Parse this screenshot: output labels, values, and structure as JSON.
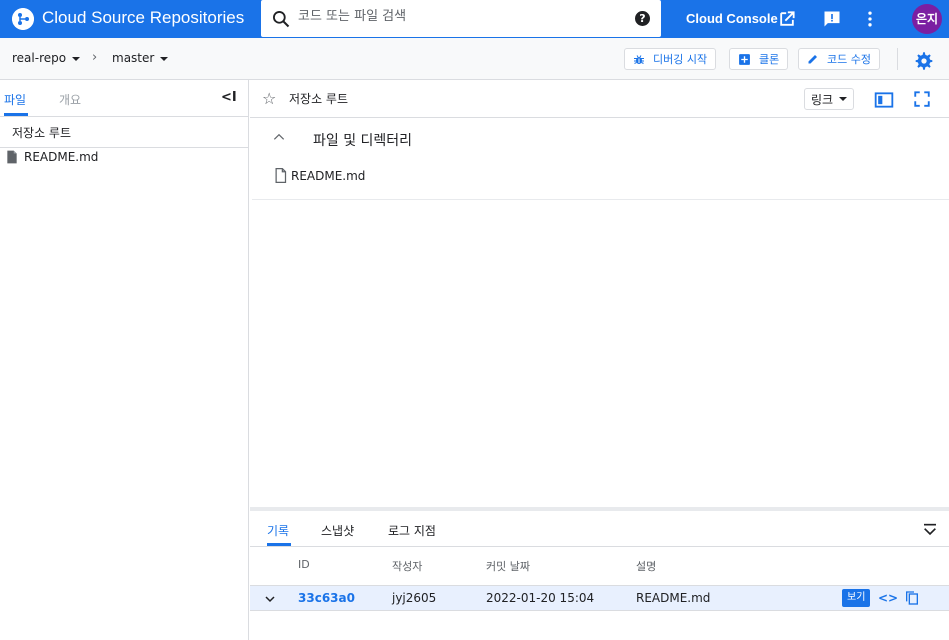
{
  "app": {
    "title": "Cloud Source Repositories"
  },
  "search": {
    "placeholder": "코드 또는 파일 검색"
  },
  "header": {
    "console_label": "Cloud Console",
    "avatar_text": "은지"
  },
  "toolbar": {
    "repo": "real-repo",
    "branch": "master",
    "debug_label": "디버깅 시작",
    "clone_label": "클론",
    "edit_label": "코드 수정"
  },
  "sidebar": {
    "tabs": [
      "파일",
      "개요"
    ],
    "root_label": "저장소 루트",
    "items": [
      {
        "label": "README.md"
      }
    ]
  },
  "main": {
    "title": "저장소 루트",
    "link_label": "링크",
    "section_title": "파일 및 디렉터리",
    "files": [
      {
        "label": "README.md"
      }
    ]
  },
  "history": {
    "tabs": [
      "기록",
      "스냅샷",
      "로그 지점"
    ],
    "columns": [
      "ID",
      "작성자",
      "커밋 날짜",
      "설명"
    ],
    "rows": [
      {
        "id": "33c63a0",
        "author": "jyj2605",
        "date": "2022-01-20 15:04",
        "description": "README.md",
        "view_label": "보기"
      }
    ]
  },
  "colors": {
    "primary": "#1a73e8",
    "avatar": "#7b1fa2"
  }
}
